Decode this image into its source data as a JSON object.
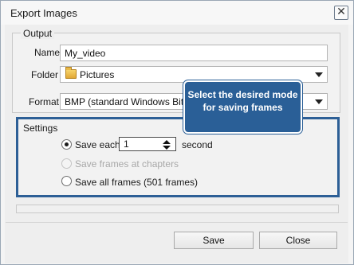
{
  "window": {
    "title": "Export Images",
    "close_glyph": "✕"
  },
  "output": {
    "group_label": "Output",
    "name_label": "Name",
    "name_value": "My_video",
    "folder_label": "Folder",
    "folder_value": "Pictures",
    "folder_icon": "folder-icon",
    "format_label": "Format",
    "format_value": "BMP (standard Windows Bitmap)"
  },
  "settings": {
    "group_label": "Settings",
    "options": [
      {
        "label": "Save each",
        "selected": true,
        "enabled": true
      },
      {
        "label": "Save frames at chapters",
        "selected": false,
        "enabled": false
      },
      {
        "label": "Save all frames (501 frames)",
        "selected": false,
        "enabled": true
      }
    ],
    "interval_value": "1",
    "interval_unit": "second"
  },
  "tooltip": {
    "text": "Select the desired mode for saving frames"
  },
  "progress": {
    "value": 0
  },
  "buttons": {
    "save_label": "Save",
    "close_label": "Close"
  },
  "colors": {
    "accent": "#2a5f97",
    "highlight_border": "#2d5f96"
  }
}
